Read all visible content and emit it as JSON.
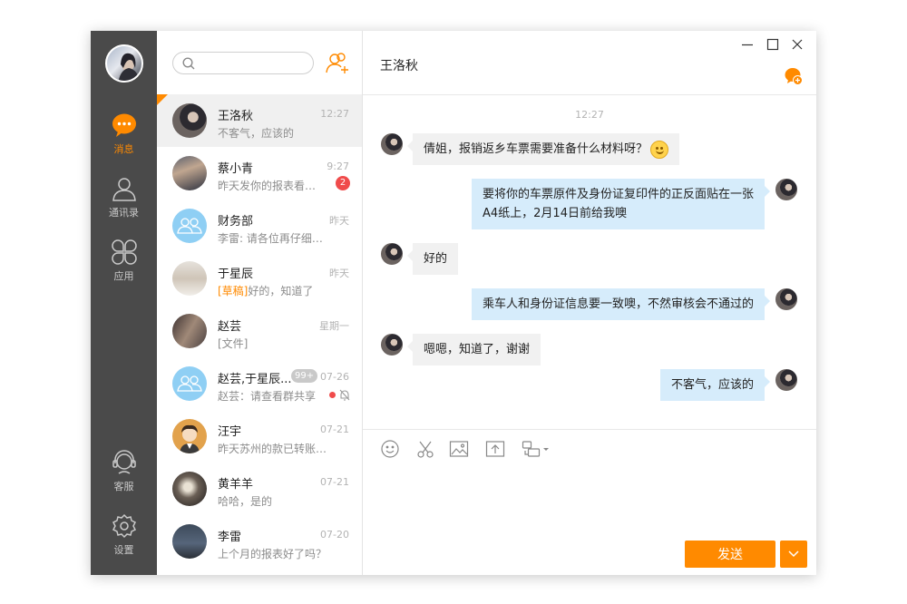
{
  "nav": {
    "messages": "消息",
    "contacts": "通讯录",
    "apps": "应用",
    "service": "客服",
    "settings": "设置"
  },
  "search": {
    "placeholder": ""
  },
  "conversations": [
    {
      "name": "王洛秋",
      "time": "12:27",
      "preview": "不客气，应该的"
    },
    {
      "name": "蔡小青",
      "time": "9:27",
      "preview": "昨天发你的报表看过...",
      "unread": "2"
    },
    {
      "name": "财务部",
      "time": "昨天",
      "preview": "李雷: 请各位再仔细核对一..."
    },
    {
      "name": "于星辰",
      "time": "昨天",
      "draft": "[草稿]",
      "preview": "好的，知道了"
    },
    {
      "name": "赵芸",
      "time": "星期一",
      "preview": "[文件]"
    },
    {
      "name": "赵芸,于星辰...",
      "time": "07-26",
      "preview": "赵芸：请查看群共享",
      "count": "99+"
    },
    {
      "name": "汪宇",
      "time": "07-21",
      "preview": "昨天苏州的款已转账，请..."
    },
    {
      "name": "黄羊羊",
      "time": "07-21",
      "preview": "哈哈，是的"
    },
    {
      "name": "李雷",
      "time": "07-20",
      "preview": "上个月的报表好了吗？"
    }
  ],
  "chat": {
    "title": "王洛秋",
    "timestamp": "12:27",
    "messages": [
      {
        "dir": "in",
        "text": "倩姐，报销返乡车票需要准备什么材料呀？"
      },
      {
        "dir": "out",
        "line1": "要将你的车票原件及身份证复印件的正反面贴在一张",
        "line2": "A4纸上，2月14日前给我噢"
      },
      {
        "dir": "in",
        "text": "好的"
      },
      {
        "dir": "out",
        "text": "乘车人和身份证信息要一致噢，不然审核会不通过的"
      },
      {
        "dir": "in",
        "text": "嗯嗯，知道了，谢谢"
      },
      {
        "dir": "out",
        "text": "不客气，应该的"
      }
    ]
  },
  "composer": {
    "send_label": "发送",
    "value": ""
  },
  "colors": {
    "accent": "#ff8a00",
    "sidebar": "#4a4a4a",
    "outgoing_bubble": "#d6ecfb",
    "incoming_bubble": "#f1f1f1",
    "badge": "#f04b4b"
  },
  "icons": {
    "sidebar": [
      "chat-bubble-icon",
      "person-icon",
      "clover-icon",
      "headset-icon",
      "gear-icon"
    ],
    "toolbar": [
      "smile-icon",
      "scissors-icon",
      "image-icon",
      "upload-icon",
      "screen-share-icon"
    ],
    "window": [
      "minimize-icon",
      "maximize-icon",
      "close-icon"
    ]
  }
}
